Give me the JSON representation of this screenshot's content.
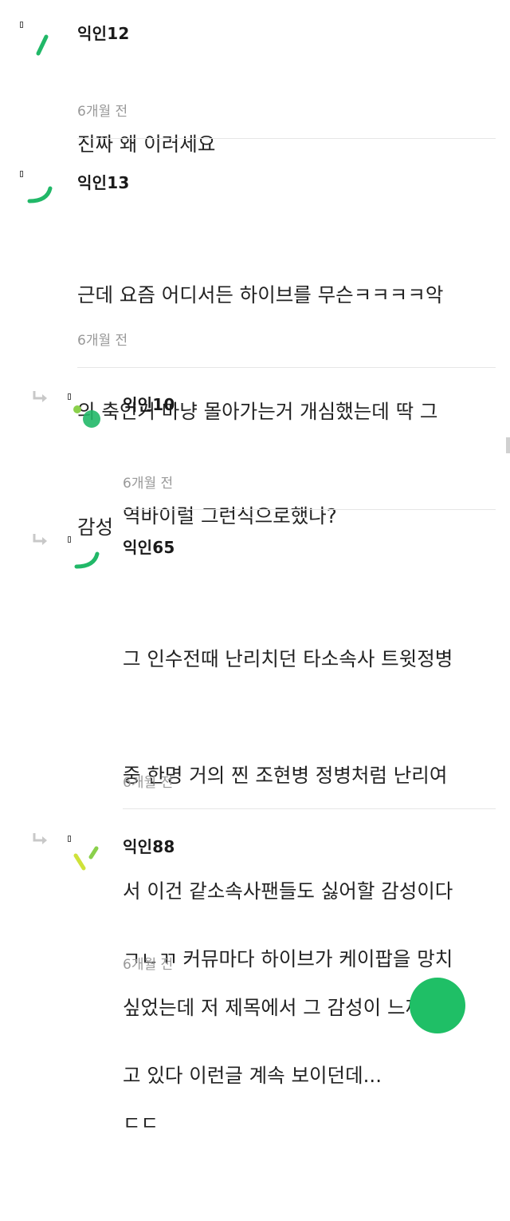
{
  "colors": {
    "accent_green": "#21b868",
    "light_green": "#8ad04b",
    "yellow_green": "#cfe23a",
    "name_text": "#1a1a1a",
    "time_text": "#999999",
    "divider": "#e6e6e6"
  },
  "comments": [
    {
      "author": "익인12",
      "lines": [
        "진짜 왜 이러세요"
      ],
      "time": "6개월 전",
      "is_reply": false,
      "avatar_icon": "green-slash-icon"
    },
    {
      "author": "익인13",
      "lines": [
        "근데 요즘 어디서든 하이브를 무슨ㅋㅋㅋㅋ악",
        "의 축인거 마냥 몰아가는거 개심했는데 딱 그",
        "감성"
      ],
      "time": "6개월 전",
      "is_reply": false,
      "avatar_icon": "green-arc-icon"
    },
    {
      "author": "익인10",
      "lines": [
        "역바이럴 그런식으로했나?"
      ],
      "time": "6개월 전",
      "is_reply": true,
      "avatar_icon": "green-dots-icon"
    },
    {
      "author": "익인65",
      "lines": [
        "그 인수전때 난리치던 타소속사 트윗정병",
        "중 한명 거의 찐 조현병 정병처럼 난리여",
        "서 이건 같소속사팬들도 싫어할 감성이다",
        "싶었는데 저 제목에서 그 감성이 느껴짐ㄷ",
        "ㄷㄷ"
      ],
      "time": "6개월 전",
      "is_reply": true,
      "avatar_icon": "green-arc-icon"
    },
    {
      "author": "익인88",
      "lines": [
        "ㄱㄴㄲ 커뮤마다 하이브가 케이팝을 망치",
        "고 있다 이런글 계속 보이던데..."
      ],
      "time": "6개월 전",
      "is_reply": true,
      "avatar_icon": "yellow-slash-icon"
    }
  ]
}
